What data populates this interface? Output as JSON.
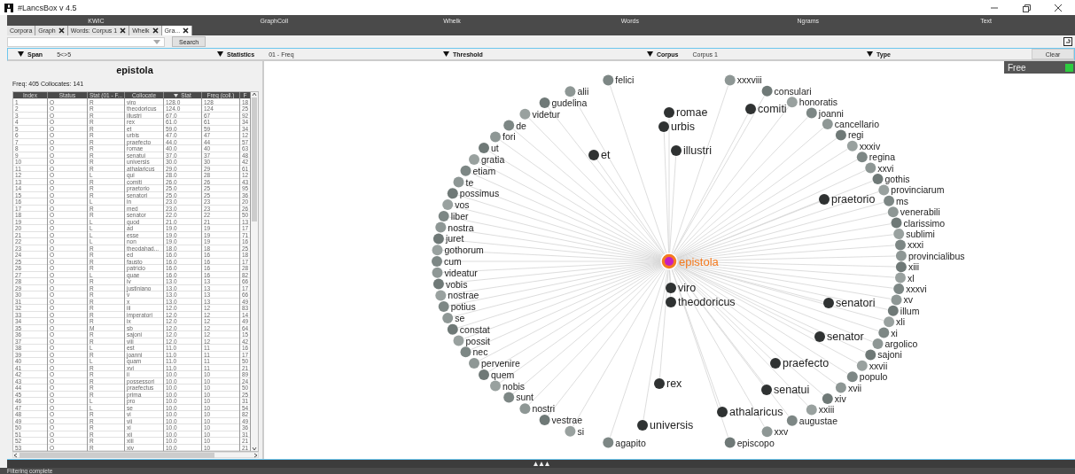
{
  "window": {
    "title": "#LancsBox v 4.5"
  },
  "modules": [
    "KWIC",
    "GraphColl",
    "Whelk",
    "Words",
    "Ngrams",
    "Text"
  ],
  "tabs": [
    {
      "label": "Corpora",
      "closable": false,
      "selected": false
    },
    {
      "label": "Graph",
      "closable": true,
      "selected": false
    },
    {
      "label": "Words: Corpus 1",
      "closable": true,
      "selected": false
    },
    {
      "label": "Whelk",
      "closable": true,
      "selected": false
    },
    {
      "label": "Gra...",
      "closable": true,
      "selected": true
    }
  ],
  "search": {
    "button": "Search"
  },
  "filters": [
    {
      "label": "Span",
      "value": "5<>5"
    },
    {
      "label": "Statistics",
      "value": "01 - Freq"
    },
    {
      "label": "Threshold"
    },
    {
      "label": "Corpus",
      "value": "Corpus 1"
    },
    {
      "label": "Type"
    }
  ],
  "clear_button": "Clear",
  "node_panel": {
    "title": "epistola",
    "summary": "Freq: 405 Collocates: 141"
  },
  "table": {
    "columns": [
      {
        "label": "Index",
        "sorted": false
      },
      {
        "label": "Status",
        "sorted": false
      },
      {
        "label": "Stat (01 - F...",
        "sorted": false
      },
      {
        "label": "Collocate",
        "sorted": false
      },
      {
        "label": "Stat",
        "sorted": true
      },
      {
        "label": "Freq (coll.)",
        "sorted": false
      },
      {
        "label": "F",
        "sorted": false
      }
    ],
    "rows": [
      [
        "1",
        "O",
        "R",
        "viro",
        "128.0",
        "128",
        "18"
      ],
      [
        "2",
        "O",
        "R",
        "theodoricus",
        "124.0",
        "124",
        "25"
      ],
      [
        "3",
        "O",
        "R",
        "illustri",
        "67.0",
        "67",
        "92"
      ],
      [
        "4",
        "O",
        "R",
        "rex",
        "61.0",
        "61",
        "34"
      ],
      [
        "5",
        "O",
        "R",
        "et",
        "59.0",
        "59",
        "34"
      ],
      [
        "6",
        "O",
        "R",
        "urbis",
        "47.0",
        "47",
        "12"
      ],
      [
        "7",
        "O",
        "R",
        "praefecto",
        "44.0",
        "44",
        "57"
      ],
      [
        "8",
        "O",
        "R",
        "romae",
        "40.0",
        "40",
        "63"
      ],
      [
        "9",
        "O",
        "R",
        "senatui",
        "37.0",
        "37",
        "48"
      ],
      [
        "10",
        "O",
        "R",
        "universis",
        "30.0",
        "30",
        "42"
      ],
      [
        "11",
        "O",
        "R",
        "athalaricus",
        "29.0",
        "29",
        "61"
      ],
      [
        "12",
        "O",
        "L",
        "qui",
        "28.0",
        "28",
        "12"
      ],
      [
        "13",
        "O",
        "R",
        "comiti",
        "26.0",
        "26",
        "43"
      ],
      [
        "14",
        "O",
        "R",
        "praetorio",
        "25.0",
        "25",
        "95"
      ],
      [
        "15",
        "O",
        "R",
        "senatori",
        "25.0",
        "25",
        "36"
      ],
      [
        "16",
        "O",
        "L",
        "in",
        "23.0",
        "23",
        "20"
      ],
      [
        "17",
        "O",
        "R",
        "med",
        "23.0",
        "23",
        "26"
      ],
      [
        "18",
        "O",
        "R",
        "senator",
        "22.0",
        "22",
        "50"
      ],
      [
        "19",
        "O",
        "L",
        "quod",
        "21.0",
        "21",
        "13"
      ],
      [
        "20",
        "O",
        "L",
        "ad",
        "19.0",
        "19",
        "17"
      ],
      [
        "21",
        "O",
        "L",
        "esse",
        "19.0",
        "19",
        "71"
      ],
      [
        "22",
        "O",
        "L",
        "non",
        "19.0",
        "19",
        "16"
      ],
      [
        "23",
        "O",
        "R",
        "theodahad...",
        "18.0",
        "18",
        "25"
      ],
      [
        "24",
        "O",
        "R",
        "ed",
        "16.0",
        "16",
        "18"
      ],
      [
        "25",
        "O",
        "R",
        "fausto",
        "16.0",
        "16",
        "17"
      ],
      [
        "26",
        "O",
        "R",
        "patricio",
        "16.0",
        "16",
        "28"
      ],
      [
        "27",
        "O",
        "L",
        "quae",
        "16.0",
        "16",
        "82"
      ],
      [
        "28",
        "O",
        "R",
        "iv",
        "13.0",
        "13",
        "66"
      ],
      [
        "29",
        "O",
        "R",
        "justiniano",
        "13.0",
        "13",
        "17"
      ],
      [
        "30",
        "O",
        "R",
        "v",
        "13.0",
        "13",
        "66"
      ],
      [
        "31",
        "O",
        "R",
        "x",
        "13.0",
        "13",
        "49"
      ],
      [
        "32",
        "O",
        "R",
        "iii",
        "12.0",
        "12",
        "83"
      ],
      [
        "33",
        "O",
        "R",
        "imperatori",
        "12.0",
        "12",
        "14"
      ],
      [
        "34",
        "O",
        "R",
        "ix",
        "12.0",
        "12",
        "49"
      ],
      [
        "35",
        "O",
        "M",
        "sb",
        "12.0",
        "12",
        "64"
      ],
      [
        "36",
        "O",
        "R",
        "sajoni",
        "12.0",
        "12",
        "15"
      ],
      [
        "37",
        "O",
        "R",
        "viii",
        "12.0",
        "12",
        "42"
      ],
      [
        "38",
        "O",
        "L",
        "est",
        "11.0",
        "11",
        "16"
      ],
      [
        "39",
        "O",
        "R",
        "joanni",
        "11.0",
        "11",
        "17"
      ],
      [
        "40",
        "O",
        "L",
        "quam",
        "11.0",
        "11",
        "50"
      ],
      [
        "41",
        "O",
        "R",
        "xvi",
        "11.0",
        "11",
        "21"
      ],
      [
        "42",
        "O",
        "R",
        "ii",
        "10.0",
        "10",
        "89"
      ],
      [
        "43",
        "O",
        "R",
        "possessori",
        "10.0",
        "10",
        "24"
      ],
      [
        "44",
        "O",
        "R",
        "praefectus",
        "10.0",
        "10",
        "50"
      ],
      [
        "45",
        "O",
        "R",
        "prima",
        "10.0",
        "10",
        "25"
      ],
      [
        "46",
        "O",
        "L",
        "pro",
        "10.0",
        "10",
        "31"
      ],
      [
        "47",
        "O",
        "L",
        "se",
        "10.0",
        "10",
        "54"
      ],
      [
        "48",
        "O",
        "R",
        "vi",
        "10.0",
        "10",
        "82"
      ],
      [
        "49",
        "O",
        "R",
        "vii",
        "10.0",
        "10",
        "49"
      ],
      [
        "50",
        "O",
        "R",
        "xi",
        "10.0",
        "10",
        "36"
      ],
      [
        "51",
        "O",
        "R",
        "xii",
        "10.0",
        "10",
        "31"
      ],
      [
        "52",
        "O",
        "R",
        "xiii",
        "10.0",
        "10",
        "21"
      ],
      [
        "53",
        "O",
        "R",
        "xiv",
        "10.0",
        "10",
        "21"
      ]
    ]
  },
  "graph": {
    "node": "epistola",
    "free": {
      "label": "Free",
      "on": true
    },
    "inner_nodes": [
      "romae",
      "urbis",
      "et",
      "illustri",
      "comiti",
      "praetorio",
      "senatori",
      "senator",
      "praefecto",
      "senatui",
      "rex",
      "universis",
      "athalaricus",
      "viro",
      "theodoricus"
    ],
    "outer_nodes": [
      "felici",
      "alii",
      "gudelina",
      "videtur",
      "de",
      "fori",
      "ut",
      "gratia",
      "etiam",
      "te",
      "possimus",
      "vos",
      "liber",
      "nostra",
      "juret",
      "gothorum",
      "cum",
      "videatur",
      "vobis",
      "nostrae",
      "potius",
      "se",
      "constat",
      "possit",
      "nec",
      "pervenire",
      "quem",
      "nobis",
      "sunt",
      "nostri",
      "vestrae",
      "si",
      "agapito",
      "xxxviii",
      "consulari",
      "honoratis",
      "joanni",
      "cancellario",
      "regi",
      "xxxiv",
      "regina",
      "xxvi",
      "gothis",
      "provinciarum",
      "ms",
      "venerabili",
      "clarissimo",
      "sublimi",
      "xxxi",
      "provincialibus",
      "xiii",
      "xl",
      "xxxvi",
      "xv",
      "illum",
      "xli",
      "xi",
      "argolico",
      "sajoni",
      "xxvii",
      "populo",
      "xvii",
      "xiv",
      "xxiii",
      "augustae",
      "xxv",
      "episcopo"
    ]
  },
  "status_bar": "Filtering complete"
}
